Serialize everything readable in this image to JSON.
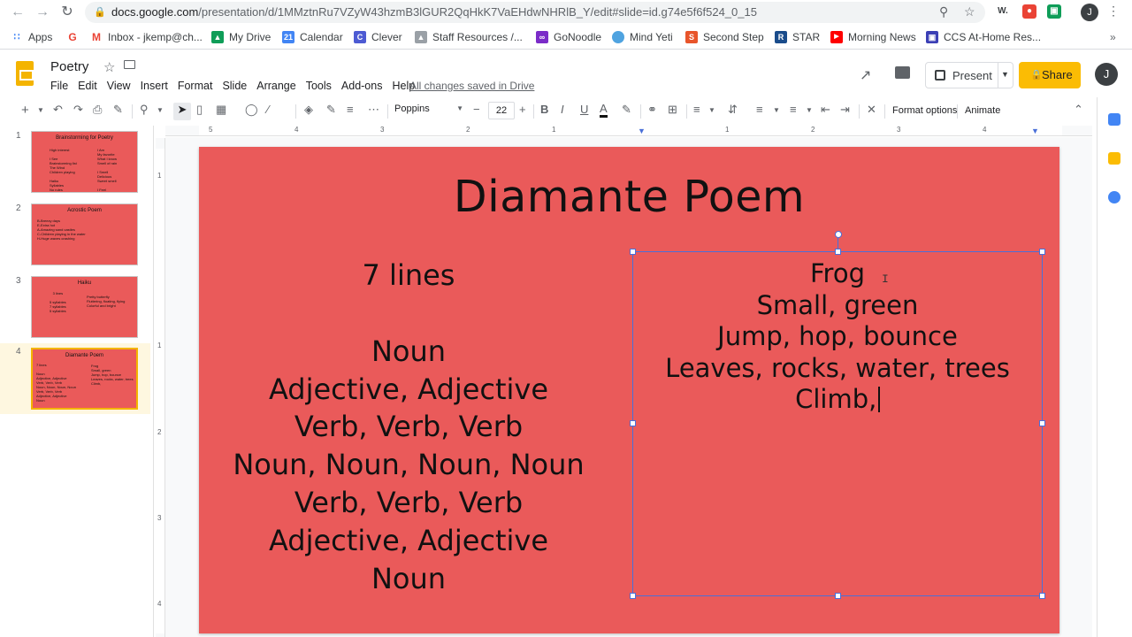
{
  "browser": {
    "url_host": "docs.google.com",
    "url_path": "/presentation/d/1MMztnRu7VZyW43hzmB3lGUR2QqHkK7VaEHdwNHRlB_Y/edit#slide=id.g74e5f6f524_0_15",
    "profile_initial": "J",
    "bookmarks": [
      {
        "label": "Apps",
        "icon": "apps-grid-icon",
        "color": "#4285f4"
      },
      {
        "label": "",
        "icon": "google-icon",
        "color": "#ea4335"
      },
      {
        "label": "Inbox - jkemp@ch...",
        "icon": "gmail-icon",
        "color": "#ea4335"
      },
      {
        "label": "My Drive",
        "icon": "drive-icon",
        "color": "#0f9d58"
      },
      {
        "label": "Calendar",
        "icon": "calendar-icon",
        "color": "#4285f4"
      },
      {
        "label": "Clever",
        "icon": "clever-icon",
        "color": "#4d5bd3"
      },
      {
        "label": "Staff Resources /...",
        "icon": "staff-resources-icon",
        "color": "#9aa0a6"
      },
      {
        "label": "GoNoodle",
        "icon": "gonoodle-icon",
        "color": "#7b2cc8"
      },
      {
        "label": "Mind Yeti",
        "icon": "mind-yeti-icon",
        "color": "#4fa3e0"
      },
      {
        "label": "Second Step",
        "icon": "second-step-icon",
        "color": "#e8552b"
      },
      {
        "label": "STAR",
        "icon": "star-renaissance-icon",
        "color": "#1a4c8b"
      },
      {
        "label": "Morning News",
        "icon": "youtube-icon",
        "color": "#ff0000"
      },
      {
        "label": "CCS At-Home Res...",
        "icon": "ccs-icon",
        "color": "#3b3fb5"
      }
    ]
  },
  "app": {
    "doc_title": "Poetry",
    "menu": [
      "File",
      "Edit",
      "View",
      "Insert",
      "Format",
      "Slide",
      "Arrange",
      "Tools",
      "Add-ons",
      "Help"
    ],
    "save_status": "All changes saved in Drive",
    "present_label": "Present",
    "share_label": "Share",
    "account_initial": "J"
  },
  "toolbar": {
    "font": "Poppins",
    "font_size": "22",
    "format_options": "Format options",
    "animate": "Animate"
  },
  "ruler": {
    "horizontal": [
      "5",
      "4",
      "3",
      "2",
      "1",
      "1",
      "2",
      "3",
      "4"
    ],
    "vertical": [
      "1",
      "1",
      "2",
      "3",
      "4"
    ]
  },
  "slides": [
    {
      "number": "1",
      "title": "Brainstorming for Poetry",
      "left": "High interest\n\nI See\nBrainstorming list\nThe Wind\nChildren playing\n\nHaiku\nSyllables\nNo rules",
      "right": "I Am\nMy favorite\nWhat I know\nSmell of rain\n\nI Smell\nDelicious\nSweet smell\n\nI Feel\nSoft breeze\nWarm light"
    },
    {
      "number": "2",
      "title": "Acrostic Poem",
      "left": "B-Breezy days\nE-Extra hot\nA-Amazing sand castles\nC-Children playing in the water\nH-Huge waves crashing",
      "right": ""
    },
    {
      "number": "3",
      "title": "Haiku",
      "left": "3 lines\n\n5 syllables\n7 syllables\n5 syllables",
      "right": "Pretty butterfly\nFluttering, floating, flying\nColorful and bright"
    },
    {
      "number": "4",
      "title": "Diamante Poem",
      "left": "7 lines\n\nNoun\nAdjective, Adjective\nVerb, Verb, Verb\nNoun, Noun, Noun, Noun\nVerb, Verb, Verb\nAdjective, Adjective\nNoun",
      "right": "Frog\nSmall, green\nJump, hop, bounce\nLeaves, rocks, water, trees\nClimb,"
    }
  ],
  "current_slide": {
    "title": "Diamante Poem",
    "left_heading": "7 lines",
    "left_lines": [
      "Noun",
      "Adjective, Adjective",
      "Verb, Verb, Verb",
      "Noun, Noun, Noun, Noun",
      "Verb, Verb, Verb",
      "Adjective, Adjective",
      "Noun"
    ],
    "right_lines": [
      "Frog",
      "Small, green",
      "Jump, hop, bounce",
      "Leaves, rocks, water, trees",
      "Climb,"
    ],
    "background_color": "#ea5a5a"
  }
}
